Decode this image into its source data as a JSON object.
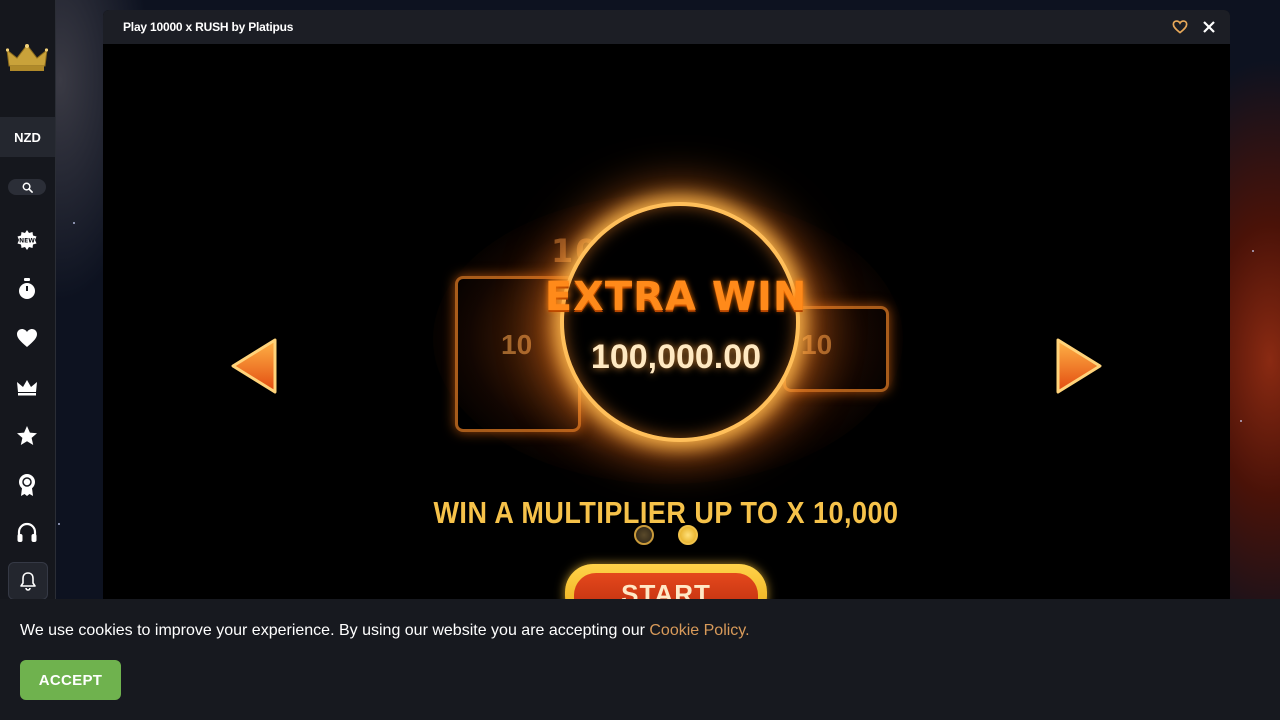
{
  "window": {
    "title": "Play 10000 x RUSH by Platipus"
  },
  "sidebar": {
    "currency": "NZD",
    "items": [
      {
        "icon": "new-badge-icon"
      },
      {
        "icon": "stopwatch-icon"
      },
      {
        "icon": "heart-icon"
      },
      {
        "icon": "crown-icon"
      },
      {
        "icon": "star-icon"
      },
      {
        "icon": "award-ribbon-icon"
      },
      {
        "icon": "headset-icon"
      },
      {
        "icon": "bell-icon"
      }
    ]
  },
  "game": {
    "ghost_title": "1000  RUSH",
    "ghost_left_value": "10",
    "ghost_right_value": "10",
    "extra_win_label": "EXTRA WIN",
    "win_amount": "100,000.00",
    "promo_text": "WIN A MULTIPLIER UP TO X 10,000",
    "start_label": "START",
    "carousel": {
      "total_slides": 2,
      "active_index": 1
    }
  },
  "cookie": {
    "message": "We use cookies to improve your experience. By using our website you are accepting our ",
    "link_text": "Cookie Policy.",
    "accept_label": "ACCEPT"
  },
  "colors": {
    "accent_gold": "#f6c24a",
    "accept_green": "#6fb24e",
    "link_orange": "#d89a5a",
    "extra_win_orange": "#ff8a1a"
  }
}
